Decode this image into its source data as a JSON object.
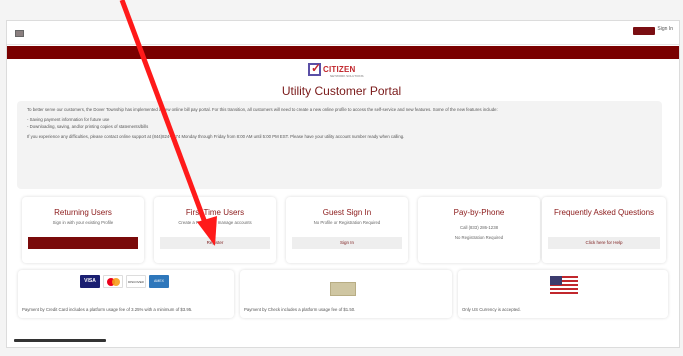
{
  "header": {
    "signin_label": "Sign In"
  },
  "logo": {
    "text": "CITIZEN",
    "subtext": "NETWORK SOLUTIONS"
  },
  "portal_title": "Utility Customer Portal",
  "notice": {
    "line1": "To better serve our customers, the Dover Township has implemented a new online bill pay portal. For this transition, all customers will need to create a new online profile to access the self-service and new features. Some of the new features include:",
    "line2": "- Saving payment information for future use",
    "line3": "- Downloading, saving, and/or printing copies of statements/bills",
    "line4": "If you experience any difficulties, please contact online support at (844)824-8374 Monday through Friday from 8:00 AM until 5:00 PM EST. Please have your utility account number ready when calling."
  },
  "cards": [
    {
      "title": "Returning Users",
      "sub": "Sign in with your existing Profile",
      "button": ""
    },
    {
      "title": "First Time Users",
      "sub": "Create a Profile and manage accounts",
      "button": "Register"
    },
    {
      "title": "Guest Sign In",
      "sub": "No Profile or Registration Required",
      "button": "Sign In"
    },
    {
      "title": "Pay-by-Phone",
      "sub": "Call (833) 286-1238",
      "sub2": "No Registration Required",
      "button": ""
    },
    {
      "title": "Frequently Asked Questions",
      "sub": "",
      "button": "Click here for Help"
    }
  ],
  "payments": {
    "card_text": "Payment by Credit Card includes a platform usage fee of 3.25% with a minimum of $3.95.",
    "check_text": "Payment by Check includes a platform usage fee of $1.50.",
    "currency_text": "Only US Currency is accepted.",
    "card_logos": [
      "VISA",
      "MasterCard",
      "DISCOVER",
      "AMEX"
    ]
  },
  "colors": {
    "brand_red": "#7a0000",
    "title_red": "#8b1a1a",
    "arrow": "#ff1a1a"
  }
}
